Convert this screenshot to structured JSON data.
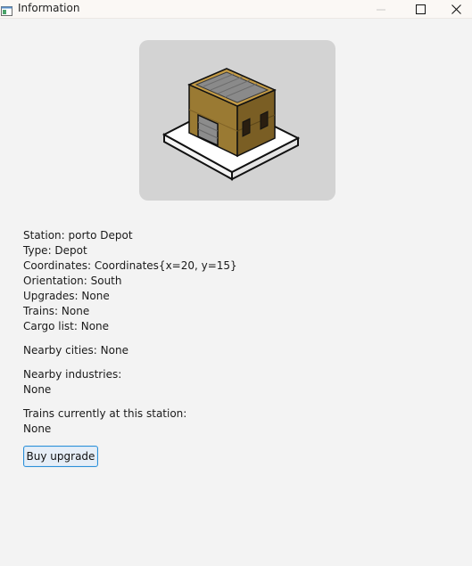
{
  "window": {
    "title": "Information"
  },
  "station": {
    "station_line": "Station: porto Depot",
    "type_line": "Type: Depot",
    "coordinates_line": "Coordinates: Coordinates{x=20, y=15}",
    "orientation_line": "Orientation: South",
    "upgrades_line": "Upgrades: None",
    "trains_line": "Trains: None",
    "cargo_line": "Cargo list: None",
    "nearby_cities_line": "Nearby cities: None",
    "nearby_industries_label": "Nearby industries:",
    "nearby_industries_value": "None",
    "trains_at_station_label": "Trains currently at this station:",
    "trains_at_station_value": "None"
  },
  "actions": {
    "buy_upgrade_label": "Buy upgrade"
  },
  "icons": {
    "app": "window-icon",
    "minimize": "minimize-icon",
    "maximize": "maximize-icon",
    "close": "close-icon",
    "station_image": "depot-building-image"
  }
}
